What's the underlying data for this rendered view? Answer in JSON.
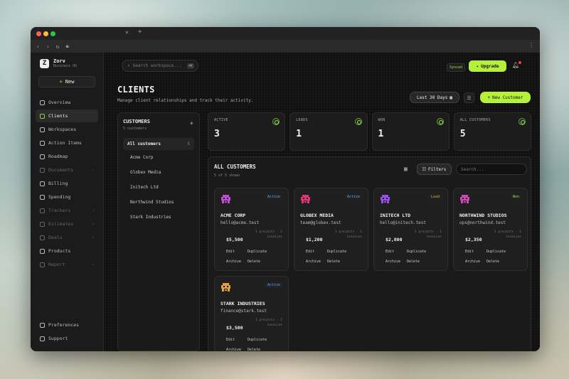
{
  "browser": {
    "tab_close": "×",
    "tab_new": "+"
  },
  "brand": {
    "name": "Zorv",
    "subtitle": "Business OS"
  },
  "sidebar": {
    "new_label": "New",
    "items": [
      {
        "label": "Overview",
        "active": false,
        "dim": false
      },
      {
        "label": "Clients",
        "active": true,
        "dim": false
      },
      {
        "label": "Workspaces",
        "active": false,
        "dim": false
      },
      {
        "label": "Action Items",
        "active": false,
        "dim": false
      },
      {
        "label": "Roadmap",
        "active": false,
        "dim": false
      },
      {
        "label": "Documents",
        "active": false,
        "dim": true
      },
      {
        "label": "Billing",
        "active": false,
        "dim": false
      },
      {
        "label": "Spending",
        "active": false,
        "dim": false
      },
      {
        "label": "Trackers",
        "active": false,
        "dim": true
      },
      {
        "label": "Estimates",
        "active": false,
        "dim": true
      },
      {
        "label": "Deals",
        "active": false,
        "dim": true
      },
      {
        "label": "Products",
        "active": false,
        "dim": false
      },
      {
        "label": "Report",
        "active": false,
        "dim": true
      }
    ],
    "bottom": [
      {
        "label": "Preferences"
      },
      {
        "label": "Support"
      }
    ]
  },
  "topbar": {
    "search_placeholder": "Search workspace...",
    "search_kbd": "⌘K",
    "synced": "Synced",
    "upgrade": "Upgrade"
  },
  "page": {
    "title": "CLIENTS",
    "subtitle": "Manage client relationships and track their activity.",
    "date_range": "Last 30 Days",
    "new_customer": "New Customer"
  },
  "customers_panel": {
    "title": "CUSTOMERS",
    "count_text": "5 customers",
    "all_label": "All customers",
    "all_count": "5",
    "items": [
      {
        "name": "Acme Corp",
        "color": "#c04bd6"
      },
      {
        "name": "Globex Media",
        "color": "#e2347a"
      },
      {
        "name": "Initech Ltd",
        "color": "#9a4ee6"
      },
      {
        "name": "Northwind Studios",
        "color": "#d046b8"
      },
      {
        "name": "Stark Industries",
        "color": "#e0a040"
      }
    ]
  },
  "stats": [
    {
      "label": "ACTIVE",
      "value": "3"
    },
    {
      "label": "LEADS",
      "value": "1"
    },
    {
      "label": "WON",
      "value": "1"
    },
    {
      "label": "ALL CUSTOMERS",
      "value": "5"
    }
  ],
  "list": {
    "title": "ALL CUSTOMERS",
    "shown": "5 of 5 shown",
    "filters": "Filters",
    "search_placeholder": "Search..."
  },
  "cards": [
    {
      "name": "ACME CORP",
      "email": "hello@acme.test",
      "status": "Active",
      "status_color": "#5aa0ff",
      "projects": "1 projects · 2",
      "invoices": "invoices",
      "revenue": "$5,500",
      "color": "#c04bd6"
    },
    {
      "name": "GLOBEX MEDIA",
      "email": "team@globex.test",
      "status": "Active",
      "status_color": "#5aa0ff",
      "projects": "1 projects · 1",
      "invoices": "invoices",
      "revenue": "$1,200",
      "color": "#e2347a"
    },
    {
      "name": "INITECH LTD",
      "email": "hello@initech.test",
      "status": "Lead",
      "status_color": "#e0a040",
      "projects": "1 projects · 1",
      "invoices": "invoices",
      "revenue": "$2,800",
      "color": "#9a4ee6"
    },
    {
      "name": "NORTHWIND STUDIOS",
      "email": "ops@northwind.test",
      "status": "Won",
      "status_color": "#9be15d",
      "projects": "1 projects · 1",
      "invoices": "invoices",
      "revenue": "$2,350",
      "color": "#d046b8"
    },
    {
      "name": "STARK INDUSTRIES",
      "email": "finance@stark.test",
      "status": "Active",
      "status_color": "#5aa0ff",
      "projects": "1 projects · 1",
      "invoices": "invoices",
      "revenue": "$3,500",
      "color": "#e0a040"
    }
  ],
  "card_actions": {
    "edit": "Edit",
    "duplicate": "Duplicate",
    "archive": "Archive",
    "delete": "Delete"
  }
}
